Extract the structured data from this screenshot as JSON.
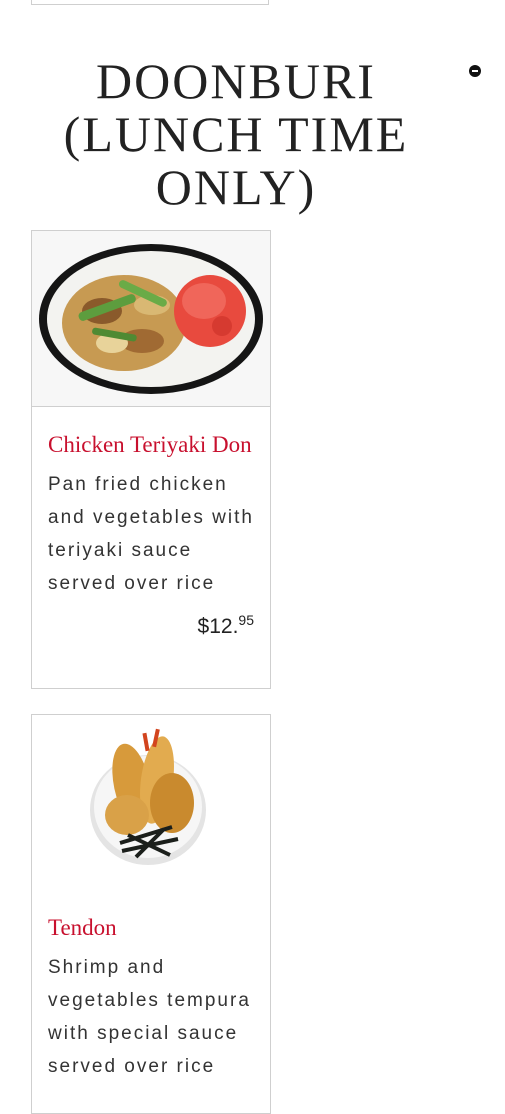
{
  "section": {
    "title": "DOONBURI (LUNCH TIME ONLY)",
    "collapse_icon": "minus-circle-icon"
  },
  "items": [
    {
      "name": "Chicken Teriyaki Don",
      "description": "Pan fried chicken and vegetables with teriyaki sauce served over rice",
      "price_main": "$12.",
      "price_cents": "95",
      "image": "chicken-teriyaki-don-photo"
    },
    {
      "name": "Tendon",
      "description": "Shrimp and vegetables tempura with special sauce served over rice",
      "image": "tendon-photo"
    }
  ],
  "colors": {
    "item_name": "#c8102e",
    "text": "#333333",
    "border": "#cfcfcf"
  }
}
